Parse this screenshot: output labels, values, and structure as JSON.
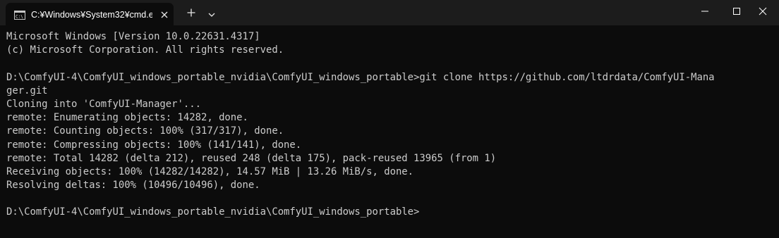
{
  "tab": {
    "title": "C:¥Windows¥System32¥cmd.e",
    "icon": "cmd-icon"
  },
  "titlebar_buttons": {
    "new_tab": "plus-icon",
    "dropdown": "chevron-down-icon",
    "minimize": "minimize-icon",
    "maximize": "maximize-icon",
    "close": "close-icon"
  },
  "terminal": {
    "lines": [
      "Microsoft Windows [Version 10.0.22631.4317]",
      "(c) Microsoft Corporation. All rights reserved.",
      "",
      "D:\\ComfyUI-4\\ComfyUI_windows_portable_nvidia\\ComfyUI_windows_portable>git clone https://github.com/ltdrdata/ComfyUI-Mana",
      "ger.git",
      "Cloning into 'ComfyUI-Manager'...",
      "remote: Enumerating objects: 14282, done.",
      "remote: Counting objects: 100% (317/317), done.",
      "remote: Compressing objects: 100% (141/141), done.",
      "remote: Total 14282 (delta 212), reused 248 (delta 175), pack-reused 13965 (from 1)",
      "Receiving objects: 100% (14282/14282), 14.57 MiB | 13.26 MiB/s, done.",
      "Resolving deltas: 100% (10496/10496), done.",
      "",
      "D:\\ComfyUI-4\\ComfyUI_windows_portable_nvidia\\ComfyUI_windows_portable>"
    ]
  },
  "colors": {
    "background": "#0c0c0c",
    "titlebar": "#1c1c1c",
    "text": "#cccccc"
  }
}
